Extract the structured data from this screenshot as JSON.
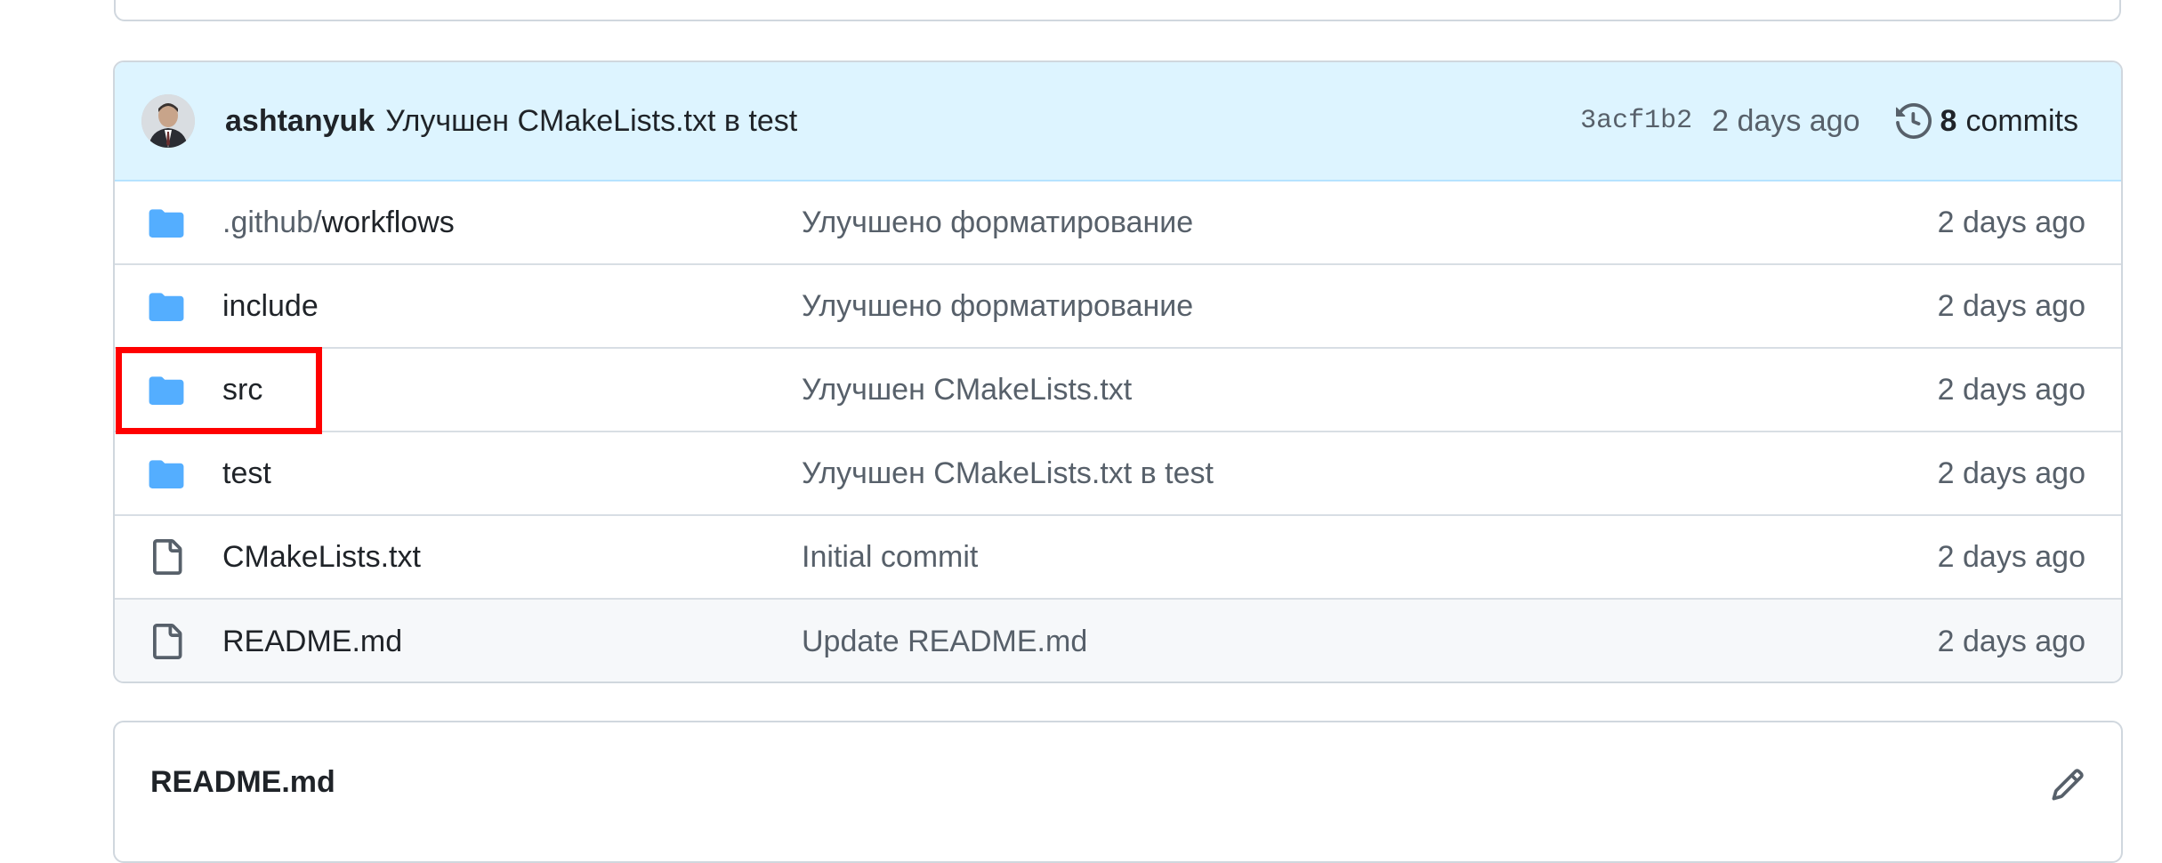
{
  "latest_commit": {
    "author": "ashtanyuk",
    "message": "Улучшен CMakeLists.txt в test",
    "sha": "3acf1b2",
    "time": "2 days ago",
    "commit_count": "8",
    "commit_count_label": "commits",
    "icon": "history-icon"
  },
  "files": [
    {
      "type": "folder",
      "name_prefix": ".github/",
      "name": "workflows",
      "commit": "Улучшено форматирование",
      "age": "2 days ago",
      "icon": "folder-icon"
    },
    {
      "type": "folder",
      "name_prefix": "",
      "name": "include",
      "commit": "Улучшено форматирование",
      "age": "2 days ago",
      "icon": "folder-icon"
    },
    {
      "type": "folder",
      "name_prefix": "",
      "name": "src",
      "commit": "Улучшен CMakeLists.txt",
      "age": "2 days ago",
      "icon": "folder-icon"
    },
    {
      "type": "folder",
      "name_prefix": "",
      "name": "test",
      "commit": "Улучшен CMakeLists.txt в test",
      "age": "2 days ago",
      "icon": "folder-icon"
    },
    {
      "type": "file",
      "name_prefix": "",
      "name": "CMakeLists.txt",
      "commit": "Initial commit",
      "age": "2 days ago",
      "icon": "file-icon"
    },
    {
      "type": "file",
      "name_prefix": "",
      "name": "README.md",
      "commit": "Update README.md",
      "age": "2 days ago",
      "icon": "file-icon"
    }
  ],
  "readme": {
    "title": "README.md",
    "edit_icon": "pencil-icon"
  },
  "colors": {
    "folder": "#54aeff",
    "highlight": "#ff0000",
    "commit_bar_bg": "#ddf4ff"
  }
}
